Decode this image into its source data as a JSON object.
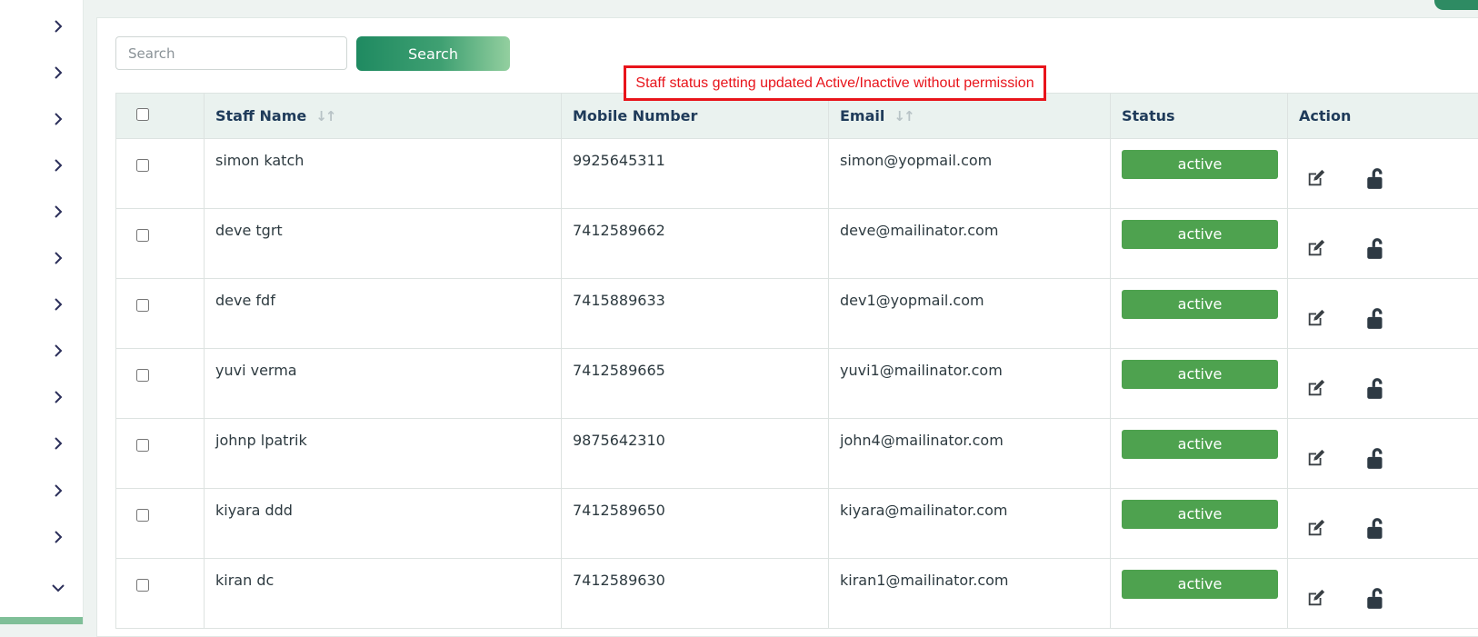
{
  "search": {
    "placeholder": "Search",
    "button_label": "Search"
  },
  "annotation": {
    "text": "Staff status getting updated Active/Inactive without permission"
  },
  "sidebar": {
    "icons": [
      "chevron-right-icon",
      "chevron-right-icon",
      "chevron-right-icon",
      "chevron-right-icon",
      "chevron-right-icon",
      "chevron-right-icon",
      "chevron-right-icon",
      "chevron-right-icon",
      "chevron-right-icon",
      "chevron-right-icon",
      "chevron-right-icon",
      "chevron-right-icon",
      "chevron-down-icon"
    ]
  },
  "colors": {
    "accent": "#2e8b63",
    "status_active": "#4ea24f",
    "annotation": "#e8141b",
    "header_bg": "#eaf2ef"
  },
  "table": {
    "columns": {
      "name": "Staff Name",
      "mobile": "Mobile Number",
      "email": "Email",
      "status": "Status",
      "action": "Action"
    },
    "sort_icon": "sort-arrows-icon",
    "rows": [
      {
        "name": "simon katch",
        "mobile": "9925645311",
        "email": "simon@yopmail.com",
        "status": "active"
      },
      {
        "name": "deve tgrt",
        "mobile": "7412589662",
        "email": "deve@mailinator.com",
        "status": "active"
      },
      {
        "name": "deve fdf",
        "mobile": "7415889633",
        "email": "dev1@yopmail.com",
        "status": "active"
      },
      {
        "name": "yuvi verma",
        "mobile": "7412589665",
        "email": "yuvi1@mailinator.com",
        "status": "active"
      },
      {
        "name": "johnp lpatrik",
        "mobile": "9875642310",
        "email": "john4@mailinator.com",
        "status": "active"
      },
      {
        "name": "kiyara ddd",
        "mobile": "7412589650",
        "email": "kiyara@mailinator.com",
        "status": "active"
      },
      {
        "name": "kiran dc",
        "mobile": "7412589630",
        "email": "kiran1@mailinator.com",
        "status": "active"
      }
    ]
  }
}
